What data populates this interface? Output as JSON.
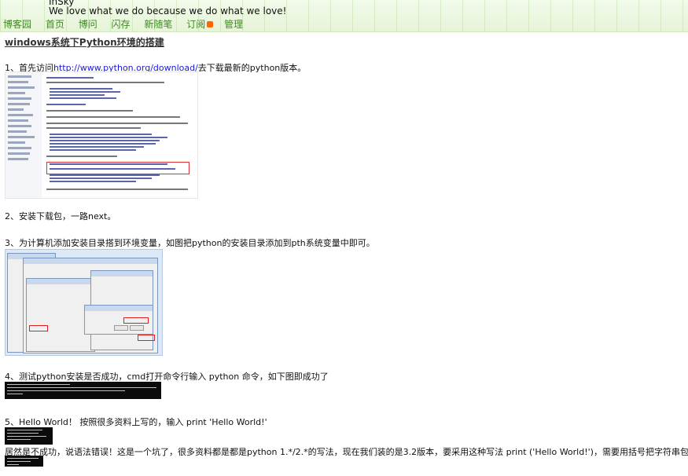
{
  "header": {
    "site_title": "InSky",
    "slogan": "We love what we do because we do what we love!",
    "nav": [
      "博客园",
      "首页",
      "博问",
      "闪存",
      "新随笔",
      "订阅",
      "管理"
    ]
  },
  "post": {
    "title": "windows系统下Python环境的搭建",
    "step1_prefix": "1、首先访问",
    "step1_link": "http://www.python.org/download/",
    "step1_suffix": "去下载最新的python版本。",
    "step2": "2、安装下载包，一路next。",
    "step3": "3、为计算机添加安装目录搭到环境变量，如图把python的安装目录添加到pth系统变量中即可。",
    "step4": "4、测试python安装是否成功，cmd打开命令行输入 python 命令，如下图即成功了",
    "step5": "5、Hello World！ 按照很多资料上写的，输入 print 'Hello World!'",
    "note": "居然是不成功，说语法错误！这是一个坑了，很多资料都是都是python 1.*/2.*的写法，现在我们装的是3.2版本，要采用这种写法 print ('Hello World!')，需要用括号把字符串包含"
  },
  "colors": {
    "nav_link": "#3d8a1e",
    "link": "#1a1ad8",
    "banner": "#e6f4d8"
  }
}
